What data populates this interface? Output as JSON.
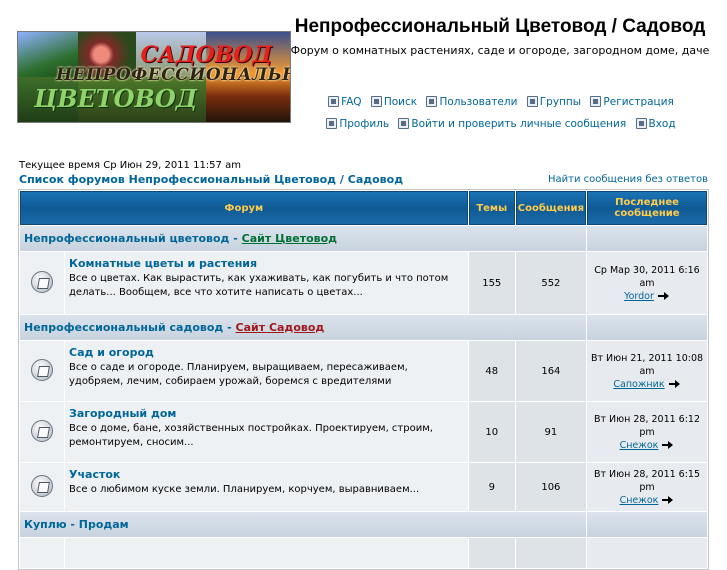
{
  "header": {
    "title": "Непрофессиональный Цветовод / Садовод",
    "description": "Форум о комнатных растениях, саде и огороде, загородном доме, даче",
    "logo_text": {
      "line1": "САДОВОД",
      "line2": "НЕПРОФЕССИОНАЛЬНЫЙ",
      "line3": "ЦВЕТОВОД"
    }
  },
  "nav": {
    "row1": [
      {
        "label": "FAQ",
        "icon": "faq-icon"
      },
      {
        "label": "Поиск",
        "icon": "search-icon"
      },
      {
        "label": "Пользователи",
        "icon": "members-icon"
      },
      {
        "label": "Группы",
        "icon": "groups-icon"
      },
      {
        "label": "Регистрация",
        "icon": "register-icon"
      }
    ],
    "row2": [
      {
        "label": "Профиль",
        "icon": "profile-icon"
      },
      {
        "label": "Войти и проверить личные сообщения",
        "icon": "messages-icon"
      },
      {
        "label": "Вход",
        "icon": "login-icon"
      }
    ]
  },
  "current_time": "Текущее время Ср Июн 29, 2011 11:57 am",
  "breadcrumb": "Список форумов Непрофессиональный Цветовод / Садовод",
  "unanswered_link": "Найти сообщения без ответов",
  "table": {
    "headers": {
      "forum": "Форум",
      "topics": "Темы",
      "posts": "Сообщения",
      "last_post": "Последнее сообщение"
    },
    "categories": [
      {
        "name": "Непрофессиональный цветовод",
        "separator": " - ",
        "link": "Сайт Цветовод",
        "forums": [
          {
            "name": "Комнатные цветы и растения",
            "description": "Все о цветах. Как вырастить, как ухаживать, как погубить и что потом делать... Вообщем, все что хотите написать о цветах...",
            "topics": "155",
            "posts": "552",
            "last_date": "Ср Мар 30, 2011 6:16 am",
            "last_user": "Yordor"
          }
        ]
      },
      {
        "name": "Непрофессиональный садовод",
        "separator": " - ",
        "link": "Сайт Садовод",
        "forums": [
          {
            "name": "Сад и огород",
            "description": "Все о саде и огороде. Планируем, выращиваем, пересаживаем, удобряем, лечим, собираем урожай, боремся с вредителями",
            "topics": "48",
            "posts": "164",
            "last_date": "Вт Июн 21, 2011 10:08 am",
            "last_user": "Сапожник"
          },
          {
            "name": "Загородный дом",
            "description": "Все о доме, бане, хозяйственных постройках. Проектируем, строим, ремонтируем, сносим...",
            "topics": "10",
            "posts": "91",
            "last_date": "Вт Июн 28, 2011 6:12 pm",
            "last_user": "Снежок"
          },
          {
            "name": "Участок",
            "description": "Все о любимом куске земли. Планируем, корчуем, выравниваем...",
            "topics": "9",
            "posts": "106",
            "last_date": "Вт Июн 28, 2011 6:15 pm",
            "last_user": "Снежок"
          }
        ]
      },
      {
        "name": "Куплю - Продам",
        "forums": []
      }
    ]
  }
}
